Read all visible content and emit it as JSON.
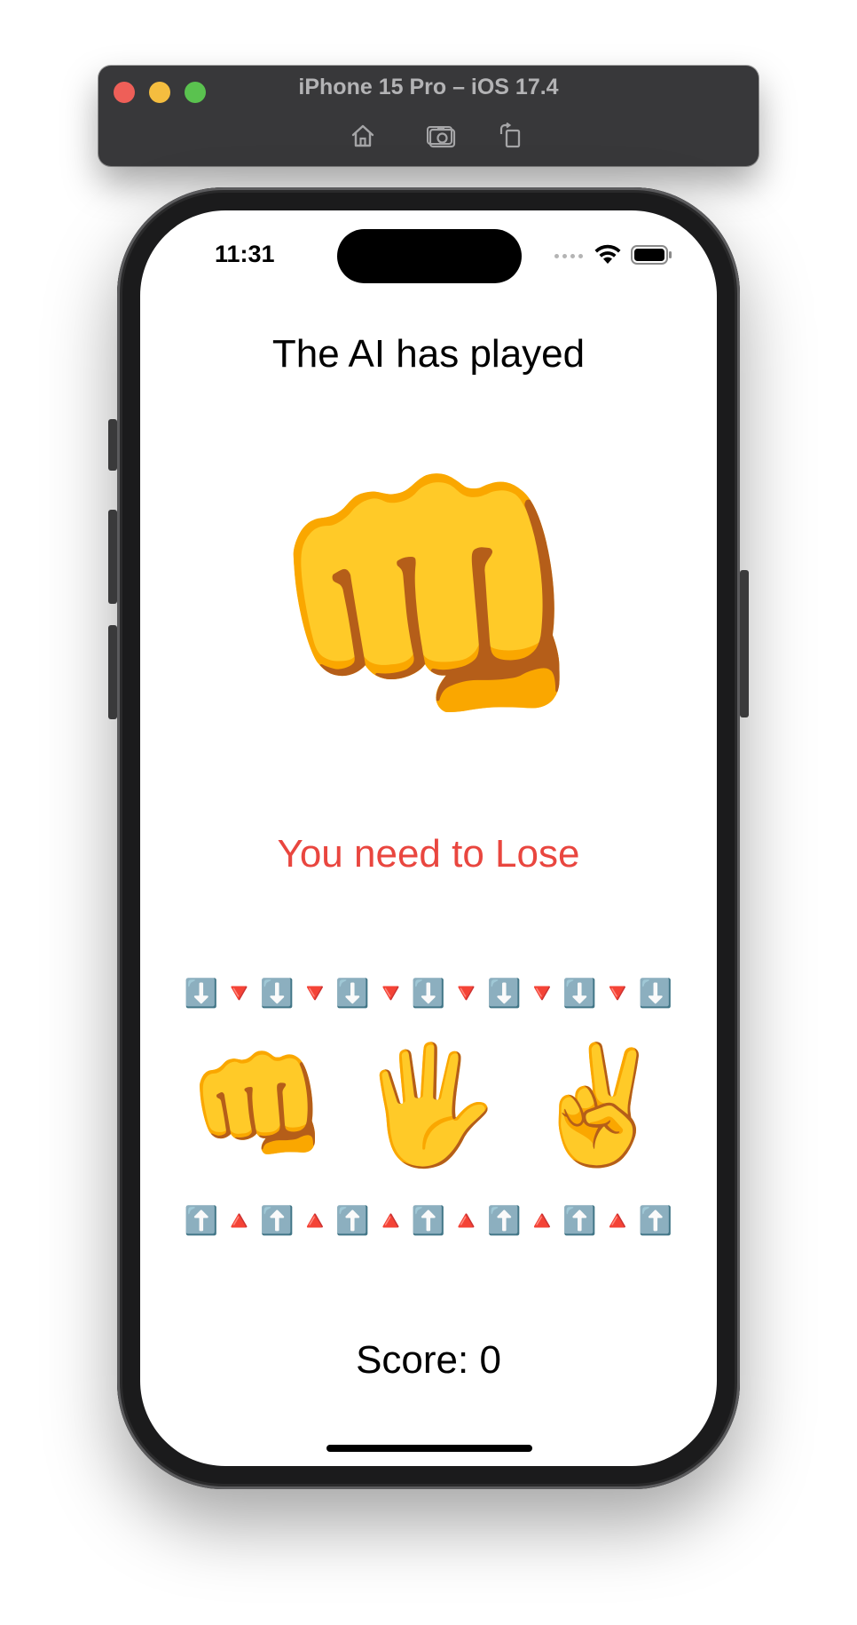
{
  "simulator": {
    "title": "iPhone 15 Pro – iOS 17.4",
    "buttons": [
      {
        "icon": "home-icon"
      },
      {
        "icon": "screenshot-icon"
      },
      {
        "icon": "rotate-icon"
      }
    ]
  },
  "status_bar": {
    "time": "11:31",
    "icons": [
      "cellular-dots-icon",
      "wifi-icon",
      "battery-icon"
    ]
  },
  "game": {
    "heading": "The AI has played",
    "ai_move": "👊",
    "instruction": "You need to Lose",
    "instruction_color": "#e9463f",
    "top_arrows": [
      "⬇️",
      "🔻",
      "⬇️",
      "🔻",
      "⬇️",
      "🔻",
      "⬇️",
      "🔻",
      "⬇️",
      "🔻",
      "⬇️",
      "🔻",
      "⬇️"
    ],
    "choices": [
      {
        "id": "rock",
        "emoji": "👊"
      },
      {
        "id": "paper",
        "emoji": "🖐️"
      },
      {
        "id": "scissors",
        "emoji": "✌️"
      }
    ],
    "bottom_arrows": [
      "⬆️",
      "🔺",
      "⬆️",
      "🔺",
      "⬆️",
      "🔺",
      "⬆️",
      "🔺",
      "⬆️",
      "🔺",
      "⬆️",
      "🔺",
      "⬆️"
    ],
    "score": "Score: 0"
  }
}
